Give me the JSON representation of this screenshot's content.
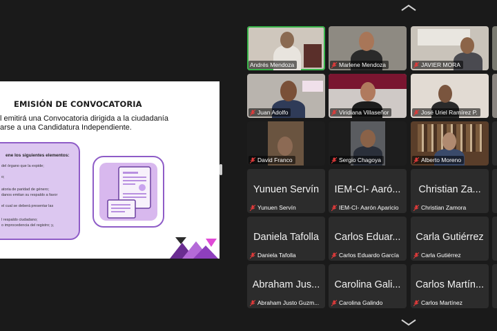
{
  "slide": {
    "title": "EMISIÓN DE CONVOCATORIA",
    "line1": "l emitirá una Convocatoria dirigida a la ciudadanía",
    "line2": "arse a una Candidatura Independiente.",
    "box_title": "ene los siguientes elementos:",
    "box_items": [
      "del órgano que la expide;",
      "o;",
      "",
      "atoria de paridad de género;",
      "danos emitan su respaldo a favor",
      "el cual se deberá presentar las",
      "",
      "l respaldo ciudadano;",
      "o improcedencia del registro; y,"
    ],
    "accent": "#8e5cc7"
  },
  "participants": [
    {
      "label": "Andrés Mendoza",
      "video": true,
      "active": true
    },
    {
      "label": "Marlene Mendoza",
      "video": true
    },
    {
      "label": "JAVIER MORA",
      "video": true
    },
    {
      "label": "Juan Adolfo",
      "video": true
    },
    {
      "label": "Viridiana Villaseñor",
      "video": true
    },
    {
      "label": "José Uriel Ramírez P.",
      "video": true
    },
    {
      "label": "David Franco",
      "video": true
    },
    {
      "label": "Sergio Chagoya",
      "video": true
    },
    {
      "label": "Alberto Moreno",
      "video": true
    },
    {
      "label": "Yunuen Servín",
      "big": "Yunuen Servín"
    },
    {
      "label": "IEM-CI- Aarón Aparicio",
      "big": "IEM-CI- Aaró..."
    },
    {
      "label": "Christian Zamora",
      "big": "Christian Za..."
    },
    {
      "label": "Daniela Tafolla",
      "big": "Daniela Tafolla"
    },
    {
      "label": "Carlos Eduardo García",
      "big": "Carlos Eduar..."
    },
    {
      "label": "Carla Gutiérrez",
      "big": "Carla Gutiérrez"
    },
    {
      "label": "Abraham Justo Guzm...",
      "big": "Abraham Jus..."
    },
    {
      "label": "Carolina Galindo",
      "big": "Carolina Gali..."
    },
    {
      "label": "Carlos Martínez",
      "big": "Carlos Martín..."
    }
  ],
  "colors": {
    "active_border": "#39b54a",
    "muted_mic": "#e03a3a"
  },
  "icons": {
    "page_up": "chevron-up-icon",
    "page_down": "chevron-down-icon",
    "mic": "mic-muted-icon"
  }
}
